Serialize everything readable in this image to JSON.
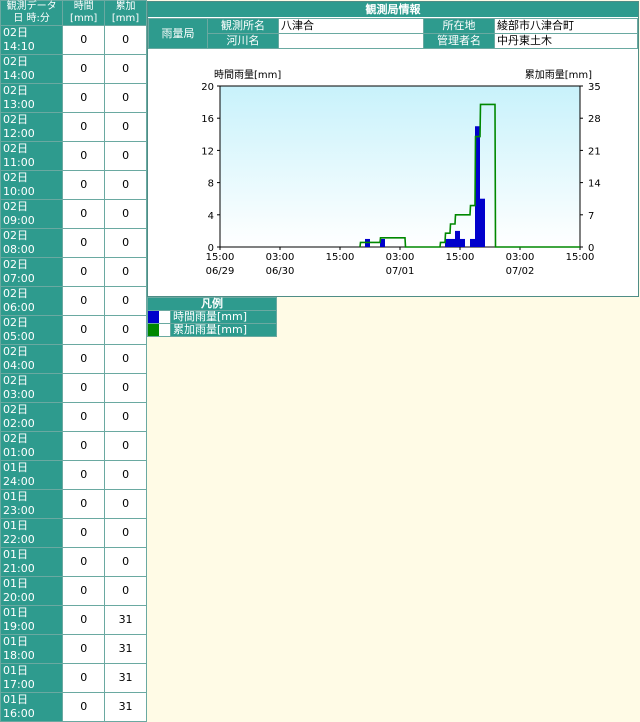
{
  "table": {
    "headers": [
      "観測データ\n日 時:分",
      "時間\n[mm]",
      "累加\n[mm]"
    ],
    "rows": [
      [
        "02日 14:10",
        "0",
        "0"
      ],
      [
        "02日 14:00",
        "0",
        "0"
      ],
      [
        "02日 13:00",
        "0",
        "0"
      ],
      [
        "02日 12:00",
        "0",
        "0"
      ],
      [
        "02日 11:00",
        "0",
        "0"
      ],
      [
        "02日 10:00",
        "0",
        "0"
      ],
      [
        "02日 09:00",
        "0",
        "0"
      ],
      [
        "02日 08:00",
        "0",
        "0"
      ],
      [
        "02日 07:00",
        "0",
        "0"
      ],
      [
        "02日 06:00",
        "0",
        "0"
      ],
      [
        "02日 05:00",
        "0",
        "0"
      ],
      [
        "02日 04:00",
        "0",
        "0"
      ],
      [
        "02日 03:00",
        "0",
        "0"
      ],
      [
        "02日 02:00",
        "0",
        "0"
      ],
      [
        "02日 01:00",
        "0",
        "0"
      ],
      [
        "01日 24:00",
        "0",
        "0"
      ],
      [
        "01日 23:00",
        "0",
        "0"
      ],
      [
        "01日 22:00",
        "0",
        "0"
      ],
      [
        "01日 21:00",
        "0",
        "0"
      ],
      [
        "01日 20:00",
        "0",
        "0"
      ],
      [
        "01日 19:00",
        "0",
        "31"
      ],
      [
        "01日 18:00",
        "0",
        "31"
      ],
      [
        "01日 17:00",
        "0",
        "31"
      ],
      [
        "01日 16:00",
        "0",
        "31"
      ]
    ]
  },
  "panel": {
    "title": "観測局情報",
    "station_type": "雨量局",
    "labels": {
      "name": "観測所名",
      "location": "所在地",
      "river": "河川名",
      "manager": "管理者名"
    },
    "values": {
      "name": "八津合",
      "location": "綾部市八津合町",
      "river": "",
      "manager": "中丹東土木"
    }
  },
  "legend": {
    "title": "凡例",
    "items": [
      {
        "label": "時間雨量[mm]",
        "color": "#0000cc"
      },
      {
        "label": "累加雨量[mm]",
        "color": "#008800"
      }
    ]
  },
  "chart_data": {
    "type": "bar",
    "ylabel_left": "時間雨量[mm]",
    "ylabel_right": "累加雨量[mm]",
    "ylim_left": [
      0,
      20
    ],
    "ylim_right": [
      0,
      35
    ],
    "yticks_left": [
      0,
      4,
      8,
      12,
      16,
      20
    ],
    "yticks_right": [
      0,
      7,
      14,
      21,
      28,
      35
    ],
    "xtick_labels": [
      {
        "time": "15:00",
        "date": "06/29"
      },
      {
        "time": "03:00",
        "date": "06/30"
      },
      {
        "time": "15:00",
        "date": ""
      },
      {
        "time": "03:00",
        "date": "07/01"
      },
      {
        "time": "15:00",
        "date": ""
      },
      {
        "time": "03:00",
        "date": "07/02"
      },
      {
        "time": "15:00",
        "date": ""
      }
    ],
    "hourly_rain_bars": [
      {
        "hour": 29,
        "value": 1
      },
      {
        "hour": 32,
        "value": 1
      },
      {
        "hour": 45,
        "value": 1
      },
      {
        "hour": 46,
        "value": 1
      },
      {
        "hour": 47,
        "value": 2
      },
      {
        "hour": 48,
        "value": 1
      },
      {
        "hour": 50,
        "value": 1
      },
      {
        "hour": 51,
        "value": 15
      },
      {
        "hour": 52,
        "value": 6
      }
    ],
    "cumulative_rain": [
      {
        "hour": 28,
        "value": 0
      },
      {
        "hour": 28.1,
        "value": 1
      },
      {
        "hour": 32,
        "value": 1
      },
      {
        "hour": 32.1,
        "value": 2
      },
      {
        "hour": 37,
        "value": 2
      },
      {
        "hour": 37.1,
        "value": 0
      },
      {
        "hour": 44,
        "value": 0
      },
      {
        "hour": 44.1,
        "value": 1
      },
      {
        "hour": 45,
        "value": 1
      },
      {
        "hour": 45.1,
        "value": 3
      },
      {
        "hour": 46,
        "value": 3
      },
      {
        "hour": 46.1,
        "value": 5
      },
      {
        "hour": 47,
        "value": 5
      },
      {
        "hour": 47.1,
        "value": 7
      },
      {
        "hour": 50,
        "value": 7
      },
      {
        "hour": 50.1,
        "value": 9
      },
      {
        "hour": 51,
        "value": 9
      },
      {
        "hour": 51.1,
        "value": 24
      },
      {
        "hour": 52,
        "value": 24
      },
      {
        "hour": 52.1,
        "value": 31
      },
      {
        "hour": 55,
        "value": 31
      },
      {
        "hour": 55.1,
        "value": 0
      },
      {
        "hour": 72,
        "value": 0
      }
    ]
  }
}
